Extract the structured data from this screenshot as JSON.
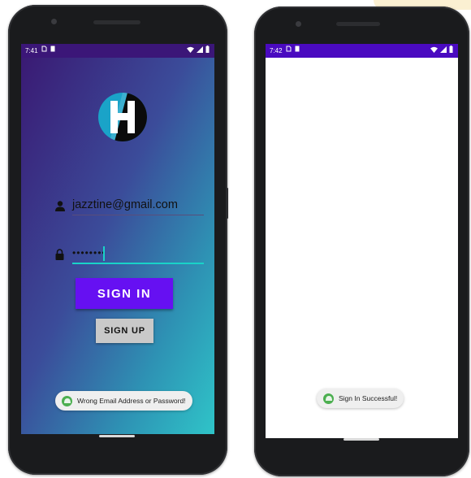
{
  "colors": {
    "accent": "#6610f2",
    "status_bar_right": "#4a0ac0",
    "status_bar_left": "#3b1678",
    "input_underline_active": "#19d3c8",
    "toast_icon": "#4caf50",
    "logo_cyan": "#1aa3c8"
  },
  "left_phone": {
    "status_bar": {
      "time": "7:41",
      "icons_left": [
        "sim-icon",
        "storage-icon"
      ],
      "icons_right": [
        "wifi-icon",
        "signal-icon",
        "battery-icon"
      ]
    },
    "logo": {
      "letter": "H"
    },
    "email": {
      "value": "jazztine@gmail.com",
      "icon": "person-icon"
    },
    "password": {
      "value": "••••••••",
      "icon": "lock-icon"
    },
    "signin_label": "SIGN IN",
    "signup_label": "SIGN UP",
    "toast": {
      "message": "Wrong Email Address or Password!",
      "icon": "android-icon"
    }
  },
  "right_phone": {
    "status_bar": {
      "time": "7:42",
      "icons_left": [
        "sim-icon",
        "storage-icon"
      ],
      "icons_right": [
        "wifi-icon",
        "signal-icon",
        "battery-icon"
      ]
    },
    "toast": {
      "message": "Sign In Successful!",
      "icon": "android-icon"
    }
  }
}
